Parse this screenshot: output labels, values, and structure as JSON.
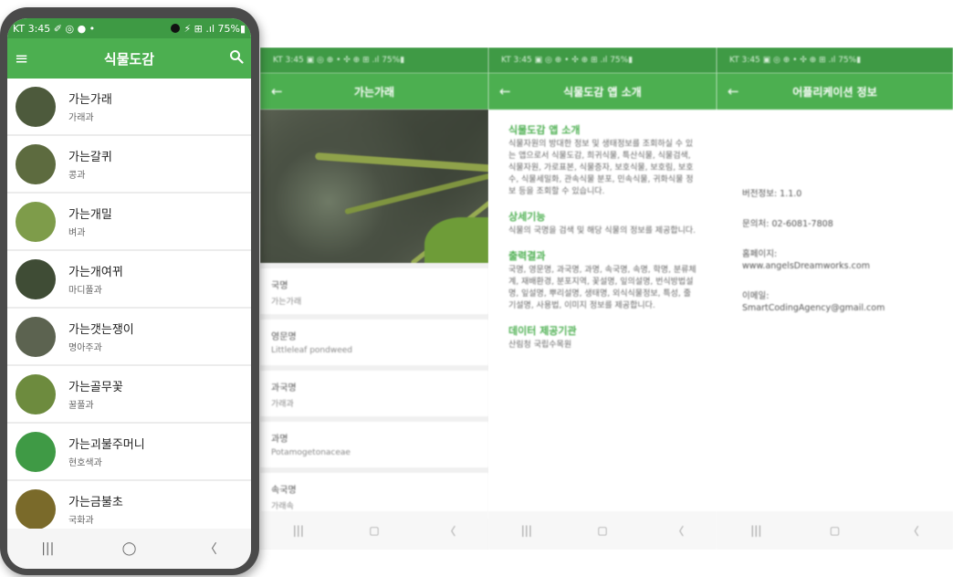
{
  "phone": {
    "status": {
      "left": "KT 3:45 ✐ ◎ ● •",
      "right": "⚡ ⊞ .ıl 75%▮"
    },
    "appbar": {
      "menu_icon": "menu-icon",
      "title": "식물도감",
      "search_icon": "search-icon"
    },
    "plants": [
      {
        "name": "가는가래",
        "family": "가래과",
        "thumb": "#4d5a3c"
      },
      {
        "name": "가는갈퀴",
        "family": "콩과",
        "thumb": "#5d6b3f"
      },
      {
        "name": "가는개밀",
        "family": "벼과",
        "thumb": "#7e9c4a"
      },
      {
        "name": "가는개여뀌",
        "family": "마디풀과",
        "thumb": "#3f4c35"
      },
      {
        "name": "가는갯는쟁이",
        "family": "명아주과",
        "thumb": "#5c6350"
      },
      {
        "name": "가는골무꽃",
        "family": "꿀풀과",
        "thumb": "#6d8b3e"
      },
      {
        "name": "가는괴불주머니",
        "family": "현호색과",
        "thumb": "#3f9a45"
      },
      {
        "name": "가는금불초",
        "family": "국화과",
        "thumb": "#7a6a2a"
      }
    ],
    "nav": {
      "recents": "|||",
      "home": "◯",
      "back": "〈"
    }
  },
  "detail": {
    "status": "KT 3:45 ▣ ◎ ⊕ •   ✣ ⊕ ⊞ .ıl 75%▮",
    "back_icon": "arrow-left-icon",
    "title": "가는가래",
    "fields": [
      {
        "label": "국명",
        "value": "가는가래"
      },
      {
        "label": "영문명",
        "value": "Littleleaf pondweed"
      },
      {
        "label": "과국명",
        "value": "가래과"
      },
      {
        "label": "과명",
        "value": "Potamogetonaceae"
      },
      {
        "label": "속국명",
        "value": "가래속"
      }
    ],
    "nav": {
      "recents": "|||",
      "home": "▢",
      "back": "〈"
    }
  },
  "about": {
    "status": "KT 3:45 ▣ ◎ ⊕ •   ✣ ⊕ ⊞ .ıl 75%▮",
    "back_icon": "arrow-left-icon",
    "title": "식물도감 앱 소개",
    "sections": [
      {
        "heading": "식물도감 앱 소개",
        "body": "식물자원의 방대한 정보 및 생태정보를 조회하실 수 있는 앱으로서 식물도감, 희귀식물, 특산식물, 식물검색, 식물자원, 가로표본, 식물증자, 보호식물, 보호림, 보호수, 식물세밀화, 관속식물 분포, 민속식물, 귀화식물 정보 등을 조회할 수 있습니다."
      },
      {
        "heading": "상세기능",
        "body": "식물의 국명을 검색 및 해당 식물의 정보를 제공합니다."
      },
      {
        "heading": "출력결과",
        "body": "국명, 영문명, 과국명, 과명, 속국명, 속명, 학명, 분류체계, 재배환경, 분포지역, 꽃설명, 잎의설명, 번식방법설명, 잎설명, 뿌리설명, 생태명, 외식식물정보, 특성, 줄기설명, 사용법, 이미지 정보를 제공합니다."
      },
      {
        "heading": "데이터 제공기관",
        "body": "산림청 국립수목원"
      }
    ],
    "nav": {
      "recents": "|||",
      "home": "▢",
      "back": "〈"
    }
  },
  "developer": {
    "status": "KT 3:45 ▣ ◎ ⊕ •   ✣ ⊕ ⊞ .ıl 75%▮",
    "back_icon": "arrow-left-icon",
    "title": "어플리케이션 정보",
    "lines": [
      "버전정보: 1.1.0",
      "문의처: 02-6081-7808",
      "홈페이지:\nwww.angelsDreamworks.com",
      "이메일:\nSmartCodingAgency@gmail.com"
    ],
    "nav": {
      "recents": "|||",
      "home": "▢",
      "back": "〈"
    }
  }
}
